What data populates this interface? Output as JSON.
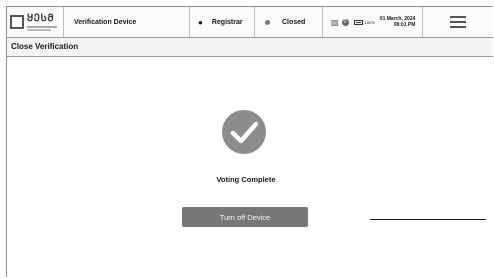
{
  "header": {
    "logo_text": "ᲧᲔᲡᲛ",
    "title": "Verification Device",
    "role": "Registrar",
    "status": "Closed",
    "badge_count": "0",
    "battery_pct": "100%",
    "date": "01 March, 2024",
    "time": "08:01 PM"
  },
  "subheader": {
    "title": "Close Verification"
  },
  "main": {
    "message": "Voting Complete",
    "turn_off_label": "Turn off Device"
  },
  "icons": {
    "logo": "logo-icon",
    "user": "user-icon",
    "status": "status-dot-icon",
    "network": "network-icon",
    "battery": "battery-icon",
    "menu": "hamburger-menu-icon",
    "success": "checkmark-circle-icon"
  },
  "colors": {
    "button_bg": "#777777",
    "check_circle": "#8d8d8d"
  }
}
